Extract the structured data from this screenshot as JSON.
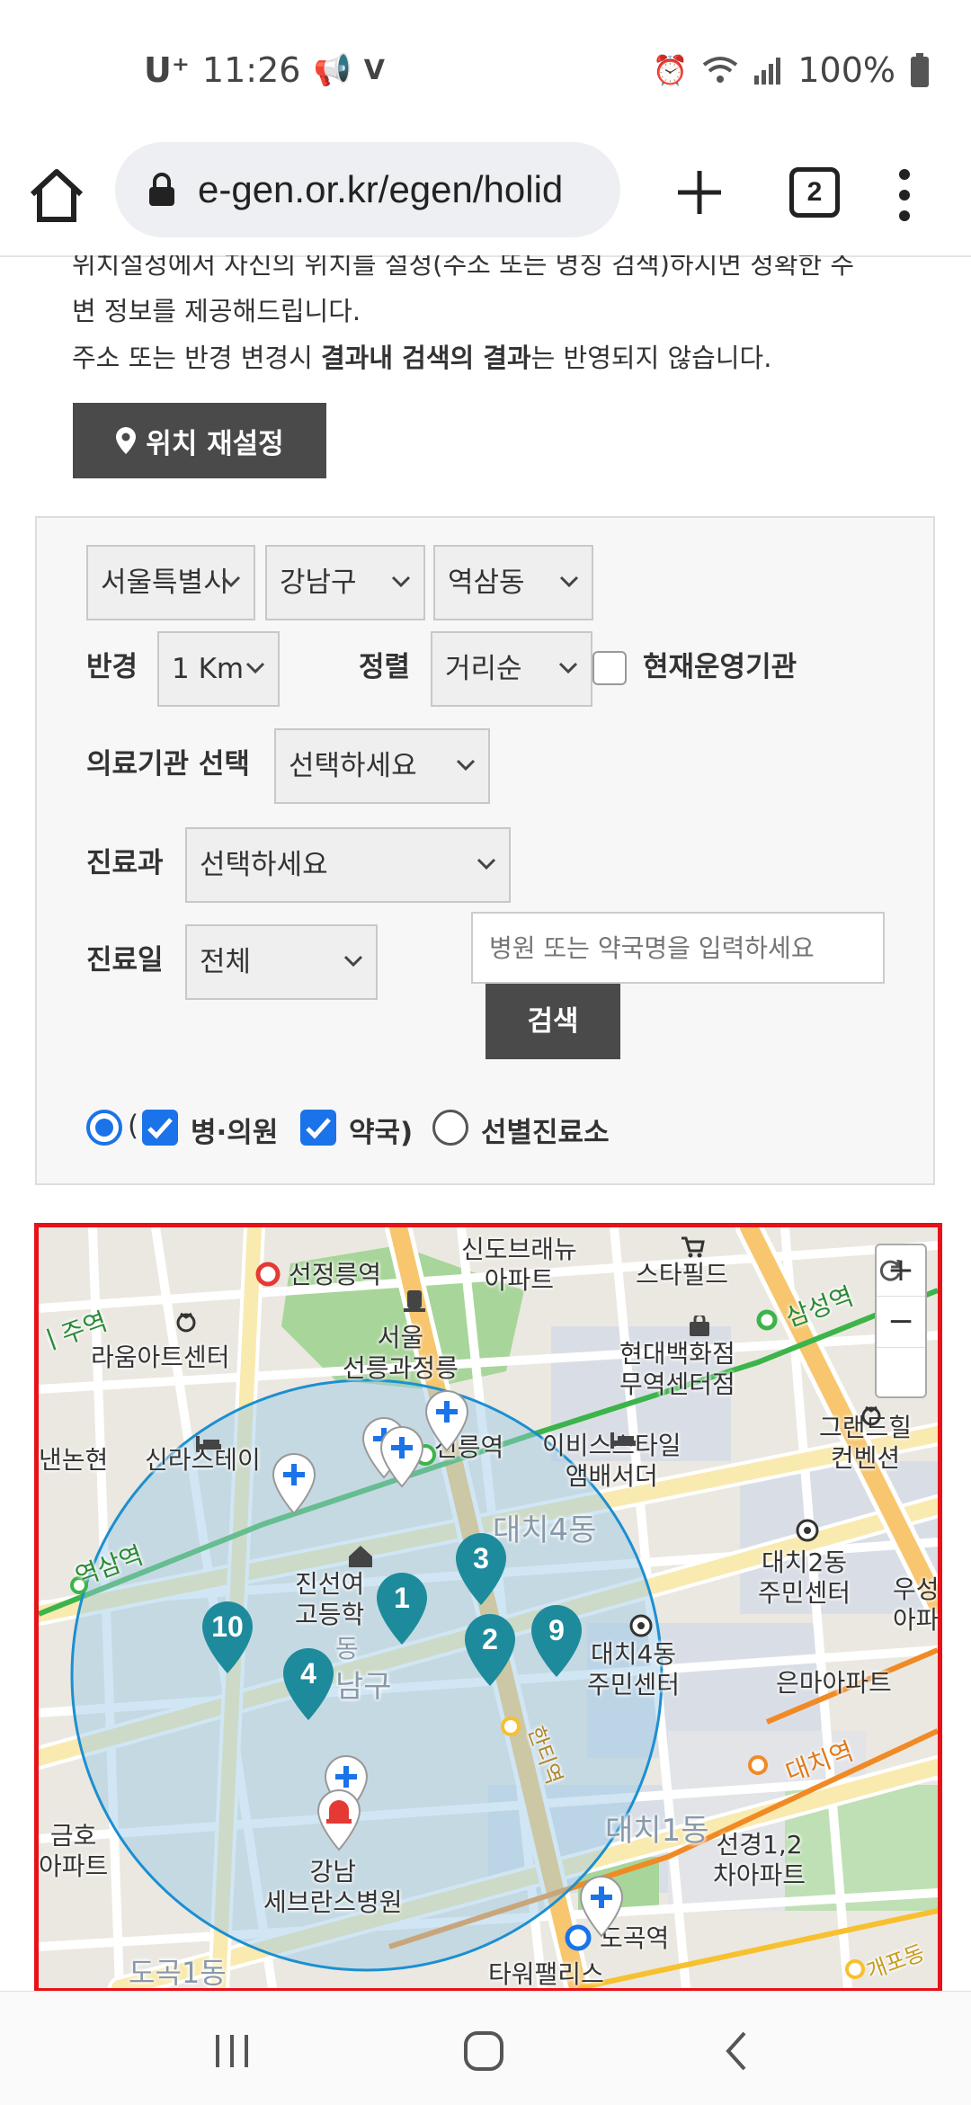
{
  "status_bar": {
    "carrier": "U⁺",
    "time": "11:26",
    "battery": "100%",
    "icons": [
      "megaphone-icon",
      "volte-icon",
      "alarm-icon",
      "wifi-icon",
      "signal-icon",
      "battery-icon"
    ]
  },
  "browser": {
    "url": "e-gen.or.kr/egen/holid",
    "tab_count": "2"
  },
  "notice": {
    "line1": "위치설정에서 자신의 위치를 설정(주소 또는 명칭 검색)하시면 정확한 주",
    "line2": "변 정보를 제공해드립니다.",
    "line3_pre": "주소 또는 반경 변경시 ",
    "line3_bold": "결과내 검색의 결과",
    "line3_post": "는 반영되지 않습니다."
  },
  "reset_button": "위치 재설정",
  "filters": {
    "city": "서울특별시",
    "district": "강남구",
    "dong": "역삼동",
    "radius_label": "반경",
    "radius_value": "1 Km",
    "sort_label": "정렬",
    "sort_value": "거리순",
    "operating_label": "현재운영기관",
    "facility_label": "의료기관 선택",
    "facility_value": "선택하세요",
    "dept_label": "진료과",
    "dept_value": "선택하세요",
    "day_label": "진료일",
    "day_value": "전체",
    "search_placeholder": "병원 또는 약국명을 입력하세요",
    "search_button": "검색"
  },
  "options": {
    "open_paren": "(",
    "hospital": "병·의원",
    "pharmacy": "약국)",
    "screening": "선별진료소"
  },
  "map": {
    "labels": {
      "sindo": "신도브래뉴\n아파트",
      "seonjeongneung": "선정릉역",
      "starfield": "스타필드",
      "samseong": "삼성역",
      "yeoksam_left": "ㅣ주역",
      "raum": "라움아트센터",
      "seoul_royal": "서울\n선릉과정릉",
      "hyundai": "현대백화점\n무역센터점",
      "grand_hill": "그랜드힐\n컨벤션",
      "nonhyeon": "낸논현",
      "shilla_stay": "신라스테이",
      "seolleung": "선릉역",
      "ibis": "이비스스타일\n앰배서더",
      "daechi4_area": "대치4동",
      "daechi2_center": "대치2동\n주민센터",
      "usung": "우성\n아파",
      "yeoksam_station": "역삼역",
      "jinseon": "진선여\n고등학",
      "gangnam_gu": "남구",
      "yeoksam2": "동",
      "daechi4_center": "대치4동\n주민센터",
      "eunma": "은마아파트",
      "hanti": "한티역",
      "daechi_station": "대치역",
      "geumho": "금호\n아파트",
      "severance": "강남\n세브란스병원",
      "daechi1": "대치1동",
      "seongyeong": "선경1,2\n차아파트",
      "dogok": "도곡역",
      "gaepo": "개포동",
      "tower_palace": "타워팰리스",
      "dogok1": "도곡1동"
    },
    "markers": [
      "1",
      "2",
      "3",
      "4",
      "9",
      "10"
    ],
    "zoom_in": "+",
    "zoom_out": "−"
  }
}
